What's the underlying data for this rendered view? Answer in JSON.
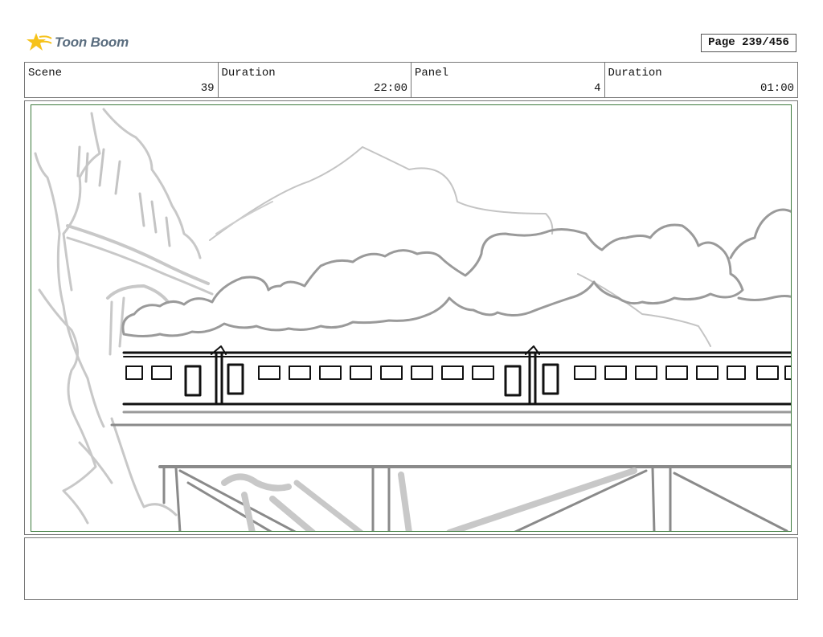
{
  "header": {
    "logo_text": "Toon Boom",
    "page_label": "Page 239/456"
  },
  "info": {
    "scene_label": "Scene",
    "scene_value": "39",
    "scene_duration_label": "Duration",
    "scene_duration_value": "22:00",
    "panel_label": "Panel",
    "panel_value": "4",
    "panel_duration_label": "Duration",
    "panel_duration_value": "01:00"
  },
  "panel": {
    "frame_color": "#3c7a3c",
    "sketch_description_icon": "train-on-bridge-sketch"
  },
  "notes": {
    "text": ""
  }
}
